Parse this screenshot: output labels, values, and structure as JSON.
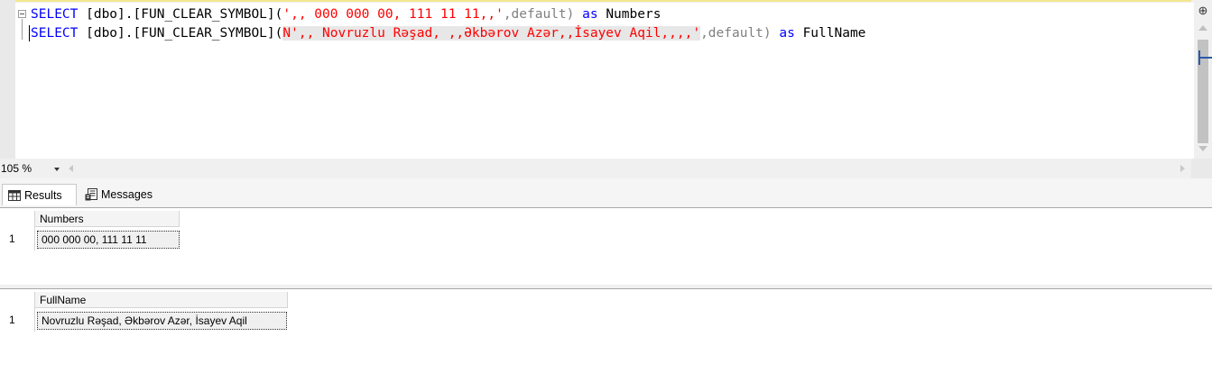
{
  "editor": {
    "line1": {
      "p1": "SELECT [dbo].[FUN_CLEAR_SYMBOL](",
      "str": "',, 000 000 00, 111 11 11,,'",
      "p2": ",default) ",
      "kw_as": "as",
      "alias": " Numbers"
    },
    "line2": {
      "p1": "SELECT [dbo].[FUN_CLEAR_SYMBOL](",
      "str": "N',, Novruzlu Rəşad, ,,Əkbərov Azər,,İsayev Aqil,,,,'",
      "p2": ",default) ",
      "kw_as": "as",
      "alias": " FullName"
    }
  },
  "zoom": {
    "value": "105 %"
  },
  "tabs": {
    "results": "Results",
    "messages": "Messages"
  },
  "grid1": {
    "column": "Numbers",
    "rows": [
      {
        "num": "1",
        "value": "000 000 00, 111 11 11"
      }
    ]
  },
  "grid2": {
    "column": "FullName",
    "rows": [
      {
        "num": "1",
        "value": "Novruzlu Rəşad, Əkbərov Azər, İsayev Aqil"
      }
    ]
  }
}
